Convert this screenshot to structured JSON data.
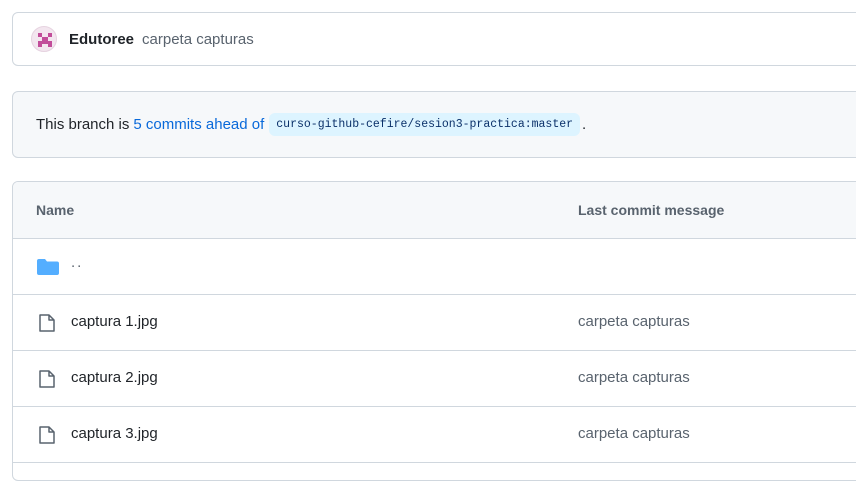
{
  "latest_commit": {
    "author": "Edutoree",
    "message": "carpeta capturas",
    "avatar_color": "#c24d9a"
  },
  "branch_status": {
    "prefix": "This branch is",
    "link_text": "5 commits ahead of",
    "ref": "curso-github-cefire/sesion3-practica:master",
    "suffix": "."
  },
  "file_table": {
    "columns": {
      "name": "Name",
      "last_commit": "Last commit message"
    },
    "parent_dir": "..",
    "files": [
      {
        "name": "captura 1.jpg",
        "message": "carpeta capturas",
        "icon": "file-icon"
      },
      {
        "name": "captura 2.jpg",
        "message": "carpeta capturas",
        "icon": "file-icon"
      },
      {
        "name": "captura 3.jpg",
        "message": "carpeta capturas",
        "icon": "file-icon"
      }
    ]
  },
  "colors": {
    "link": "#0969da",
    "folder": "#54aeff",
    "border": "#d0d7de",
    "muted": "#59636e"
  }
}
